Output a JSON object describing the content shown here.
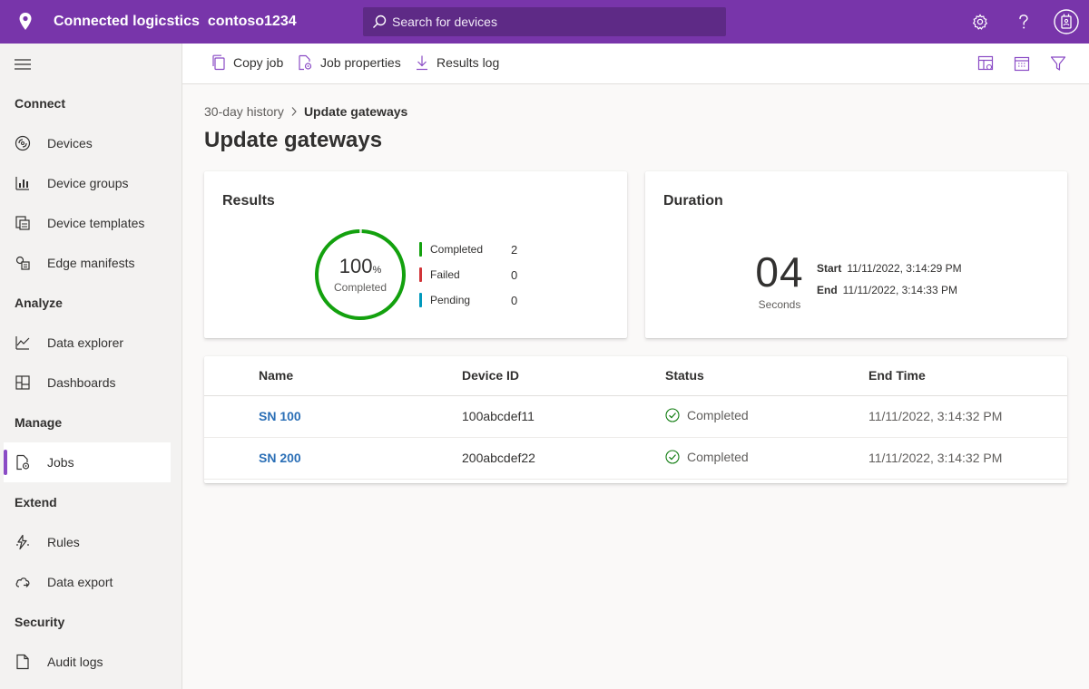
{
  "header": {
    "app_name": "Connected logicstics",
    "tenant": "contoso1234",
    "search_placeholder": "Search for devices",
    "brand_color": "#7835aa",
    "icons": [
      "location-icon",
      "search-icon",
      "settings-icon",
      "help-icon",
      "user-badge-icon"
    ]
  },
  "sidebar": {
    "sections": {
      "connect": "Connect",
      "analyze": "Analyze",
      "manage": "Manage",
      "extend": "Extend",
      "security": "Security"
    },
    "items": {
      "devices": "Devices",
      "device_groups": "Device groups",
      "device_templates": "Device templates",
      "edge_manifests": "Edge manifests",
      "data_explorer": "Data explorer",
      "dashboards": "Dashboards",
      "jobs": "Jobs",
      "rules": "Rules",
      "data_export": "Data export",
      "audit_logs": "Audit logs"
    },
    "active_item": "Jobs"
  },
  "toolbar": {
    "copy_job": "Copy job",
    "job_properties": "Job properties",
    "results_log": "Results log",
    "right_icons": [
      "columns-icon",
      "calendar-icon",
      "filter-icon"
    ]
  },
  "breadcrumb": {
    "parent": "30-day history",
    "current": "Update gateways"
  },
  "page_title": "Update gateways",
  "results_card": {
    "title": "Results",
    "percent": "100",
    "percent_sign": "%",
    "percent_label": "Completed",
    "completion_fraction": 1.0,
    "legend": [
      {
        "label": "Completed",
        "count": "2",
        "color": "#13a10e"
      },
      {
        "label": "Failed",
        "count": "0",
        "color": "#d13438"
      },
      {
        "label": "Pending",
        "count": "0",
        "color": "#0099bc"
      }
    ]
  },
  "duration_card": {
    "title": "Duration",
    "value": "04",
    "unit": "Seconds",
    "start_label": "Start",
    "start_value": "11/11/2022, 3:14:29 PM",
    "end_label": "End",
    "end_value": "11/11/2022, 3:14:33 PM"
  },
  "devices_table": {
    "columns": [
      "Name",
      "Device ID",
      "Status",
      "End Time"
    ],
    "rows": [
      {
        "name": "SN 100",
        "device_id": "100abcdef11",
        "status": "Completed",
        "end_time": "11/11/2022, 3:14:32 PM"
      },
      {
        "name": "SN 200",
        "device_id": "200abcdef22",
        "status": "Completed",
        "end_time": "11/11/2022, 3:14:32 PM"
      }
    ]
  }
}
